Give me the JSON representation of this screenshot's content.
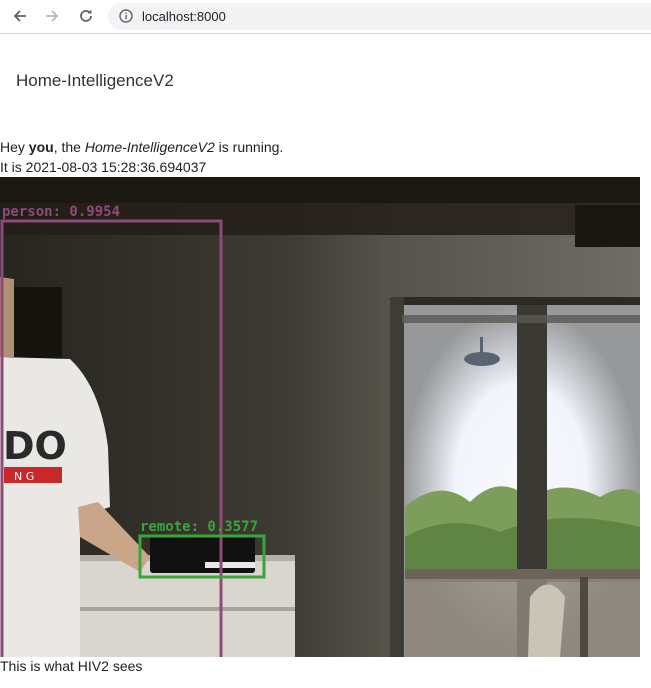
{
  "browser": {
    "url": "localhost:8000",
    "icons": [
      "back-arrow-icon",
      "forward-arrow-icon",
      "reload-icon",
      "info-icon"
    ]
  },
  "page": {
    "title": "Home-IntelligenceV2",
    "greeting": {
      "prefix": "Hey ",
      "name": "you",
      "middle": ", the ",
      "app": "Home-IntelligenceV2",
      "suffix": " is running."
    },
    "time_prefix": "It is ",
    "timestamp": "2021-08-03 15:28:36.694037",
    "caption": "This is what HIV2 sees"
  },
  "detections": [
    {
      "label": "person: 0.9954",
      "color": "#8e4a78"
    },
    {
      "label": "remote: 0.3577",
      "color": "#3aa53a"
    }
  ]
}
